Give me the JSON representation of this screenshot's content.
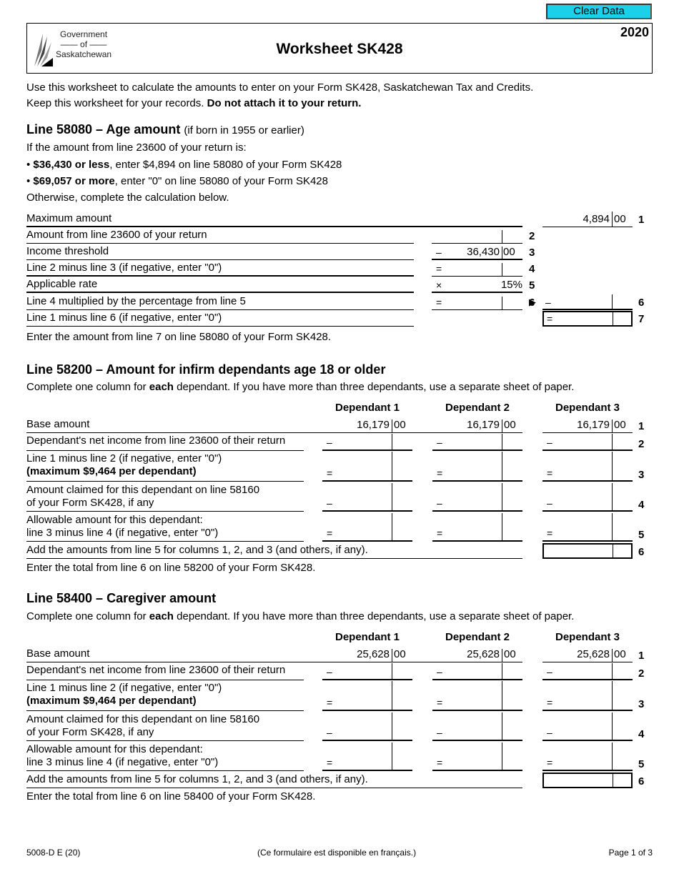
{
  "toolbar": {
    "clear_label": "Clear Data"
  },
  "header": {
    "logo_lines": [
      "Government",
      "of",
      "Saskatchewan"
    ],
    "title": "Worksheet SK428",
    "year": "2020"
  },
  "intro": {
    "line1": "Use this worksheet to calculate the amounts to enter on your Form SK428, Saskatchewan Tax and Credits.",
    "line2_normal": "Keep this worksheet for your records. ",
    "line2_bold": "Do not attach it to your return."
  },
  "age": {
    "heading": "Line 58080 – Age amount",
    "heading_note": "(if born in 1955 or earlier)",
    "lead": "If the amount from line 23600 of your return is:",
    "bullet1_bold": "$36,430 or less",
    "bullet1_rest": ", enter $4,894 on line 58080 of your Form SK428",
    "bullet2_bold": "$69,057 or more",
    "bullet2_rest": ", enter \"0\" on line 58080 of your Form SK428",
    "otherwise": "Otherwise, complete the calculation below.",
    "rows": [
      {
        "label": "Maximum amount",
        "num": "1",
        "dollars": "4,894",
        "cents": "00"
      },
      {
        "label": "Amount from line 23600 of your return",
        "num": "2"
      },
      {
        "label": "Income threshold",
        "num": "3",
        "sym": "–",
        "dollars": "36,430",
        "cents": "00"
      },
      {
        "label": "Line 2 minus line 3 (if negative, enter \"0\")",
        "num": "4",
        "sym": "="
      },
      {
        "label": "Applicable rate",
        "num": "5",
        "sym": "×",
        "rate": "15%"
      },
      {
        "label": "Line 4 multiplied by the percentage from line 5",
        "num": "6",
        "sym": "=",
        "sym2": "–",
        "arrow": "▶"
      },
      {
        "label": "Line 1 minus line 6 (if negative, enter \"0\")",
        "num": "7",
        "sym": "="
      }
    ],
    "footer": "Enter the amount from line 7 on line 58080 of your Form SK428."
  },
  "infirm": {
    "heading": "Line 58200 – Amount for infirm dependants age 18 or older",
    "lead_a": "Complete one column for ",
    "lead_b": "each",
    "lead_c": " dependant. If you have more than three dependants, use a separate sheet of paper.",
    "columns": [
      "Dependant 1",
      "Dependant 2",
      "Dependant 3"
    ],
    "base_dollars": "16,179",
    "base_cents": "00",
    "rows": [
      {
        "label1": "Base amount",
        "num": "1"
      },
      {
        "label1": "Dependant's net income from line 23600 of their return",
        "num": "2",
        "sym": "–"
      },
      {
        "label1": "Line 1 minus line 2 (if negative, enter \"0\")",
        "label2": "(maximum $9,464 per dependant)",
        "num": "3",
        "sym": "="
      },
      {
        "label1": "Amount claimed for this dependant on line 58160",
        "label2": "of your Form SK428, if any",
        "num": "4",
        "sym": "–"
      },
      {
        "label1": "Allowable amount for this dependant:",
        "label2": "line 3 minus line 4 (if negative, enter \"0\")",
        "num": "5",
        "sym": "="
      },
      {
        "label1": "Add the amounts from line 5 for columns 1, 2, and 3 (and others, if any).",
        "num": "6"
      }
    ],
    "footer": "Enter the total from line 6 on line 58200 of your Form SK428."
  },
  "caregiver": {
    "heading": "Line 58400 – Caregiver amount",
    "lead_a": "Complete one column for ",
    "lead_b": "each",
    "lead_c": " dependant. If you have more than three dependants, use a separate sheet of paper.",
    "columns": [
      "Dependant 1",
      "Dependant 2",
      "Dependant 3"
    ],
    "base_dollars": "25,628",
    "base_cents": "00",
    "rows": [
      {
        "label1": "Base amount",
        "num": "1"
      },
      {
        "label1": "Dependant's net income from line 23600 of their return",
        "num": "2",
        "sym": "–"
      },
      {
        "label1": "Line 1 minus line 2 (if negative, enter \"0\")",
        "label2": "(maximum $9,464 per dependant)",
        "num": "3",
        "sym": "="
      },
      {
        "label1": "Amount claimed for this dependant on line 58160",
        "label2": "of your Form SK428, if any",
        "num": "4",
        "sym": "–"
      },
      {
        "label1": "Allowable amount for this dependant:",
        "label2": "line 3 minus line 4 (if negative, enter \"0\")",
        "num": "5",
        "sym": "="
      },
      {
        "label1": "Add the amounts from line 5 for columns 1, 2, and 3 (and others, if any).",
        "num": "6"
      }
    ],
    "footer": "Enter the total from line 6 on line 58400 of your Form SK428."
  },
  "footer": {
    "form_code": "5008-D E (20)",
    "french_note": "(Ce formulaire est disponible en français.)",
    "page": "Page 1 of 3"
  }
}
